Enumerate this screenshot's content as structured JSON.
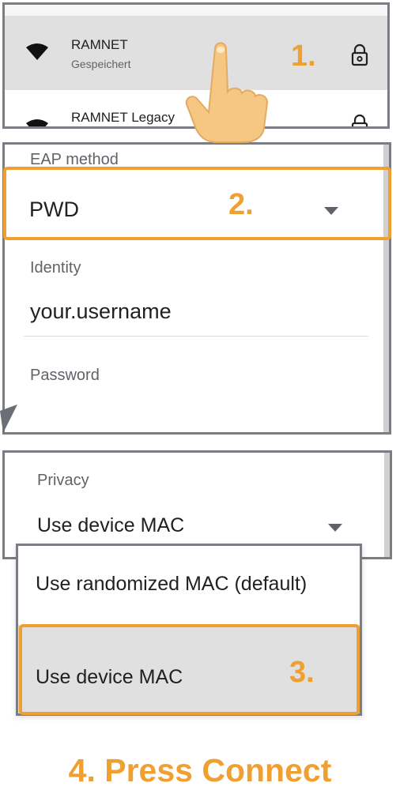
{
  "wifi_list": {
    "networks": [
      {
        "name": "RAMNET",
        "status": "Gespeichert",
        "icon": "wifi-icon",
        "secured": true
      },
      {
        "name": "RAMNET Legacy",
        "icon": "wifi-icon",
        "secured": true
      }
    ],
    "step_label": "1."
  },
  "eap": {
    "label": "EAP method",
    "value": "PWD",
    "step_label": "2.",
    "identity_label": "Identity",
    "identity_value": "your.username",
    "password_label": "Password"
  },
  "privacy": {
    "label": "Privacy",
    "value": "Use device MAC",
    "options": [
      "Use randomized MAC (default)",
      "Use device MAC"
    ],
    "step_label": "3."
  },
  "instruction": "4. Press Connect",
  "colors": {
    "accent": "#f0a030",
    "selected_row": "#e0e0e0",
    "border": "#7a7d84"
  }
}
